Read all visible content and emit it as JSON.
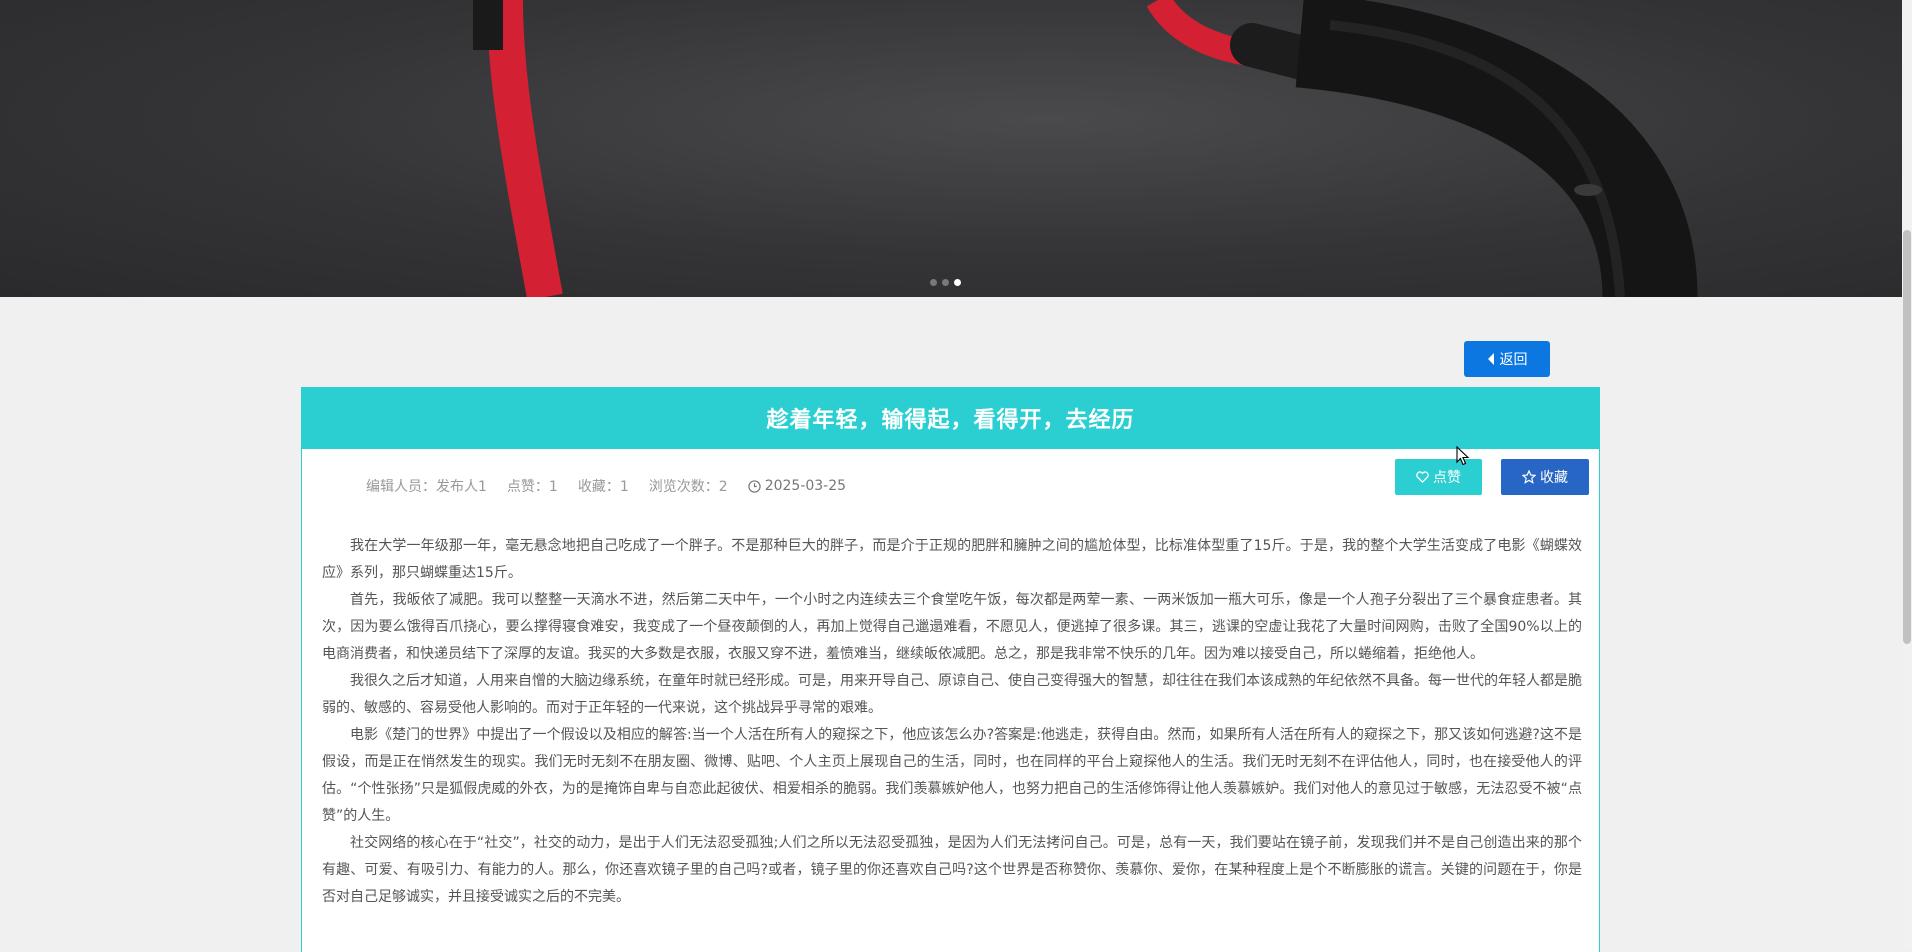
{
  "carousel": {
    "slide_count": 3,
    "active_index": 2
  },
  "header": {
    "back_label": "返回"
  },
  "article": {
    "title": "趁着年轻，输得起，看得开，去经历",
    "meta": {
      "editor": "编辑人员：发布人1",
      "likes": "点赞：1",
      "favorites": "收藏：1",
      "views": "浏览次数：2",
      "date": "2025-03-25"
    },
    "actions": {
      "like_label": "点赞",
      "favorite_label": "收藏"
    },
    "paragraphs": [
      "我在大学一年级那一年，毫无悬念地把自己吃成了一个胖子。不是那种巨大的胖子，而是介于正规的肥胖和臃肿之间的尴尬体型，比标准体型重了15斤。于是，我的整个大学生活变成了电影《蝴蝶效应》系列，那只蝴蝶重达15斤。",
      "首先，我皈依了减肥。我可以整整一天滴水不进，然后第二天中午，一个小时之内连续去三个食堂吃午饭，每次都是两荤一素、一两米饭加一瓶大可乐，像是一个人孢子分裂出了三个暴食症患者。其次，因为要么饿得百爪挠心，要么撑得寝食难安，我变成了一个昼夜颠倒的人，再加上觉得自己邋遢难看，不愿见人，便逃掉了很多课。其三，逃课的空虚让我花了大量时间网购，击败了全国90%以上的电商消费者，和快递员结下了深厚的友谊。我买的大多数是衣服，衣服又穿不进，羞愤难当，继续皈依减肥。总之，那是我非常不快乐的几年。因为难以接受自己，所以蜷缩着，拒绝他人。",
      "我很久之后才知道，人用来自憎的大脑边缘系统，在童年时就已经形成。可是，用来开导自己、原谅自己、使自己变得强大的智慧，却往往在我们本该成熟的年纪依然不具备。每一世代的年轻人都是脆弱的、敏感的、容易受他人影响的。而对于正年轻的一代来说，这个挑战异乎寻常的艰难。",
      "电影《楚门的世界》中提出了一个假设以及相应的解答:当一个人活在所有人的窥探之下，他应该怎么办?答案是:他逃走，获得自由。然而，如果所有人活在所有人的窥探之下，那又该如何逃避?这不是假设，而是正在悄然发生的现实。我们无时无刻不在朋友圈、微博、贴吧、个人主页上展现自己的生活，同时，也在同样的平台上窥探他人的生活。我们无时无刻不在评估他人，同时，也在接受他人的评估。“个性张扬”只是狐假虎威的外衣，为的是掩饰自卑与自恋此起彼伏、相爱相杀的脆弱。我们羡慕嫉妒他人，也努力把自己的生活修饰得让他人羡慕嫉妒。我们对他人的意见过于敏感，无法忍受不被“点赞”的人生。",
      "社交网络的核心在于“社交”，社交的动力，是出于人们无法忍受孤独;人们之所以无法忍受孤独，是因为人们无法拷问自己。可是，总有一天，我们要站在镜子前，发现我们并不是自己创造出来的那个有趣、可爱、有吸引力、有能力的人。那么，你还喜欢镜子里的自己吗?或者，镜子里的你还喜欢自己吗?这个世界是否称赞你、羡慕你、爱你，在某种程度上是个不断膨胀的谎言。关键的问题在于，你是否对自己足够诚实，并且接受诚实之后的不完美。"
    ]
  }
}
